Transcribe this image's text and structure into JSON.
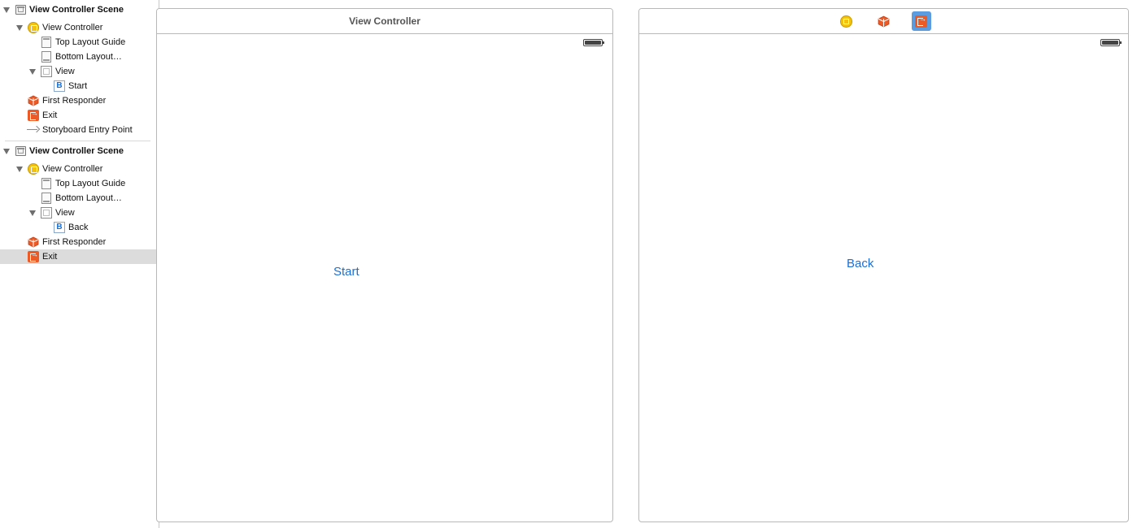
{
  "outline": {
    "scene1": {
      "title": "View Controller Scene",
      "view_controller": "View Controller",
      "top_layout_guide": "Top Layout Guide",
      "bottom_layout_guide": "Bottom Layout…",
      "view": "View",
      "button": "Start",
      "first_responder": "First Responder",
      "exit": "Exit",
      "entry_point": "Storyboard Entry Point"
    },
    "scene2": {
      "title": "View Controller Scene",
      "view_controller": "View Controller",
      "top_layout_guide": "Top Layout Guide",
      "bottom_layout_guide": "Bottom Layout…",
      "view": "View",
      "button": "Back",
      "first_responder": "First Responder",
      "exit": "Exit"
    },
    "selected_item": "scene2.exit"
  },
  "canvas": {
    "scene1": {
      "title": "View Controller",
      "button_label": "Start"
    },
    "scene2": {
      "dock_icons": [
        "view-controller-icon",
        "first-responder-icon",
        "exit-icon"
      ],
      "active_dock_icon": "exit-icon",
      "button_label": "Back"
    }
  },
  "colors": {
    "accent_blue": "#1a6fd6",
    "view_controller_yellow": "#f3c20f",
    "exit_orange": "#ec5a26",
    "selection_gray": "#dcdcdc",
    "dock_active_blue": "#5b9bdf"
  }
}
